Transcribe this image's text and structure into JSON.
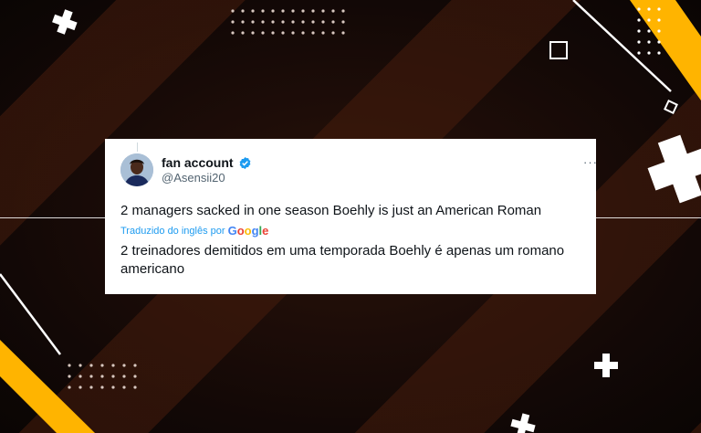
{
  "tweet": {
    "display_name": "fan account",
    "handle": "@Asensii20",
    "text": "2 managers sacked in one season Boehly is just an American Roman",
    "translated_by": "Traduzido do inglês por",
    "translation": "2 treinadores demitidos em uma temporada Boehly é apenas um romano americano",
    "more_label": "···"
  },
  "google_logo": {
    "letters": [
      "G",
      "o",
      "o",
      "g",
      "l",
      "e"
    ]
  },
  "icons": {
    "verified": "verified-badge-icon",
    "more": "more-options-icon"
  },
  "colors": {
    "accent_yellow": "#ffb400",
    "verified_blue": "#1d9bf0",
    "background_dark": "#0c0705"
  }
}
